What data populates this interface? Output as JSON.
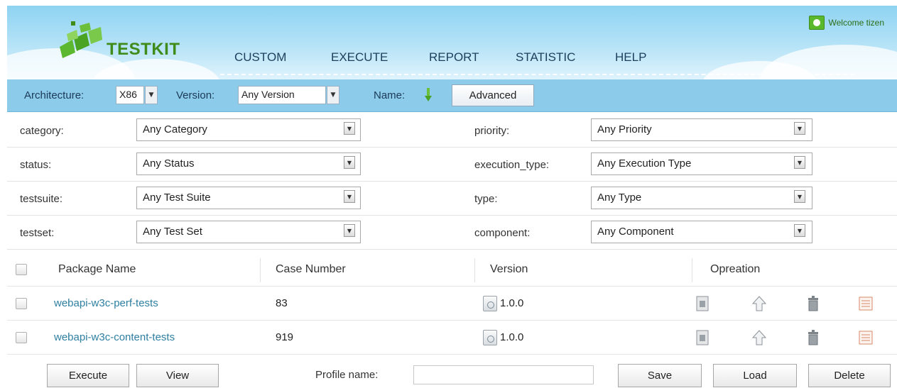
{
  "header": {
    "logo_text": "TESTKIT",
    "welcome": "Welcome tizen",
    "nav": [
      {
        "label": "CUSTOM"
      },
      {
        "label": "EXECUTE"
      },
      {
        "label": "REPORT"
      },
      {
        "label": "STATISTIC"
      },
      {
        "label": "HELP"
      }
    ]
  },
  "filterbar": {
    "architecture_label": "Architecture:",
    "architecture_value": "X86",
    "version_label": "Version:",
    "version_value": "Any Version",
    "name_label": "Name:",
    "advanced_button": "Advanced"
  },
  "criteria": {
    "left": [
      {
        "label": "category:",
        "value": "Any Category"
      },
      {
        "label": "status:",
        "value": "Any Status"
      },
      {
        "label": "testsuite:",
        "value": "Any Test Suite"
      },
      {
        "label": "testset:",
        "value": "Any Test Set"
      }
    ],
    "right": [
      {
        "label": "priority:",
        "value": "Any Priority"
      },
      {
        "label": "execution_type:",
        "value": "Any Execution Type"
      },
      {
        "label": "type:",
        "value": "Any Type"
      },
      {
        "label": "component:",
        "value": "Any Component"
      }
    ]
  },
  "table": {
    "headers": {
      "package_name": "Package Name",
      "case_number": "Case Number",
      "version": "Version",
      "operation": "Opreation"
    },
    "rows": [
      {
        "package": "webapi-w3c-perf-tests",
        "cases": "83",
        "version": "1.0.0"
      },
      {
        "package": "webapi-w3c-content-tests",
        "cases": "919",
        "version": "1.0.0"
      }
    ]
  },
  "footer": {
    "execute_button": "Execute",
    "view_button": "View",
    "profile_label": "Profile name:",
    "profile_value": "",
    "save_button": "Save",
    "load_button": "Load",
    "delete_button": "Delete"
  },
  "colors": {
    "header_sky": "#8ed3f2",
    "filterbar": "#8ccbea",
    "logo_green": "#3f8c1a",
    "link": "#2f7fa0"
  }
}
